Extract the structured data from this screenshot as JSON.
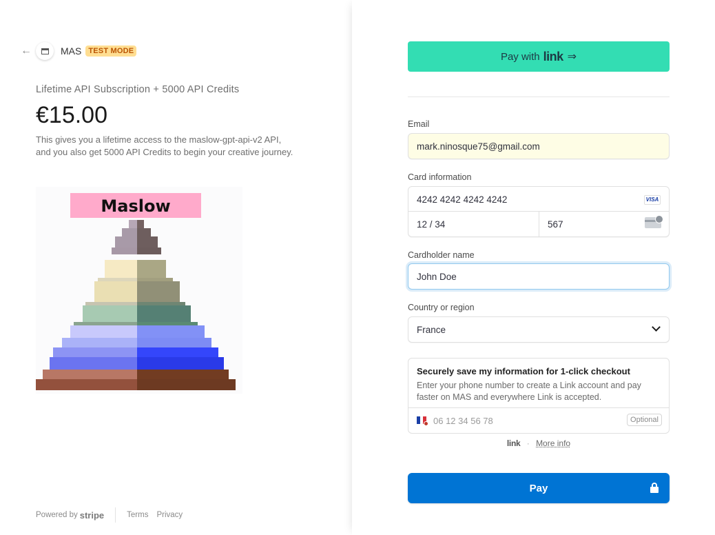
{
  "merchant": {
    "name": "MAS",
    "badge": "TEST MODE"
  },
  "product": {
    "name": "Lifetime API Subscription + 5000 API Credits",
    "price": "€15.00",
    "description": "This gives you a lifetime access to the maslow-gpt-api-v2 API, and you also get 5000 API Credits to begin your creative journey.",
    "image_title": "Maslow"
  },
  "footer": {
    "powered_by": "Powered by",
    "brand": "stripe",
    "terms": "Terms",
    "privacy": "Privacy"
  },
  "payment": {
    "link_button": {
      "prefix": "Pay with",
      "brand": "link",
      "arrow": "⇒"
    },
    "email": {
      "label": "Email",
      "value": "mark.ninosque75@gmail.com"
    },
    "card": {
      "label": "Card information",
      "number": "4242 4242 4242 4242",
      "brand_icon": "VISA",
      "expiry": "12 / 34",
      "cvc": "567"
    },
    "cardholder": {
      "label": "Cardholder name",
      "value": "John Doe"
    },
    "country": {
      "label": "Country or region",
      "value": "France"
    },
    "save": {
      "title": "Securely save my information for 1-click checkout",
      "text": "Enter your phone number to create a Link account and pay faster on MAS and everywhere Link is accepted.",
      "phone_placeholder": "06 12 34 56 78",
      "optional": "Optional"
    },
    "link_footer": {
      "brand": "link",
      "dot": "·",
      "more": "More info"
    },
    "pay_button": "Pay"
  },
  "colors": {
    "link_green": "#33ddb3",
    "pay_blue": "#0074d4",
    "test_badge_bg": "#ffde92"
  }
}
